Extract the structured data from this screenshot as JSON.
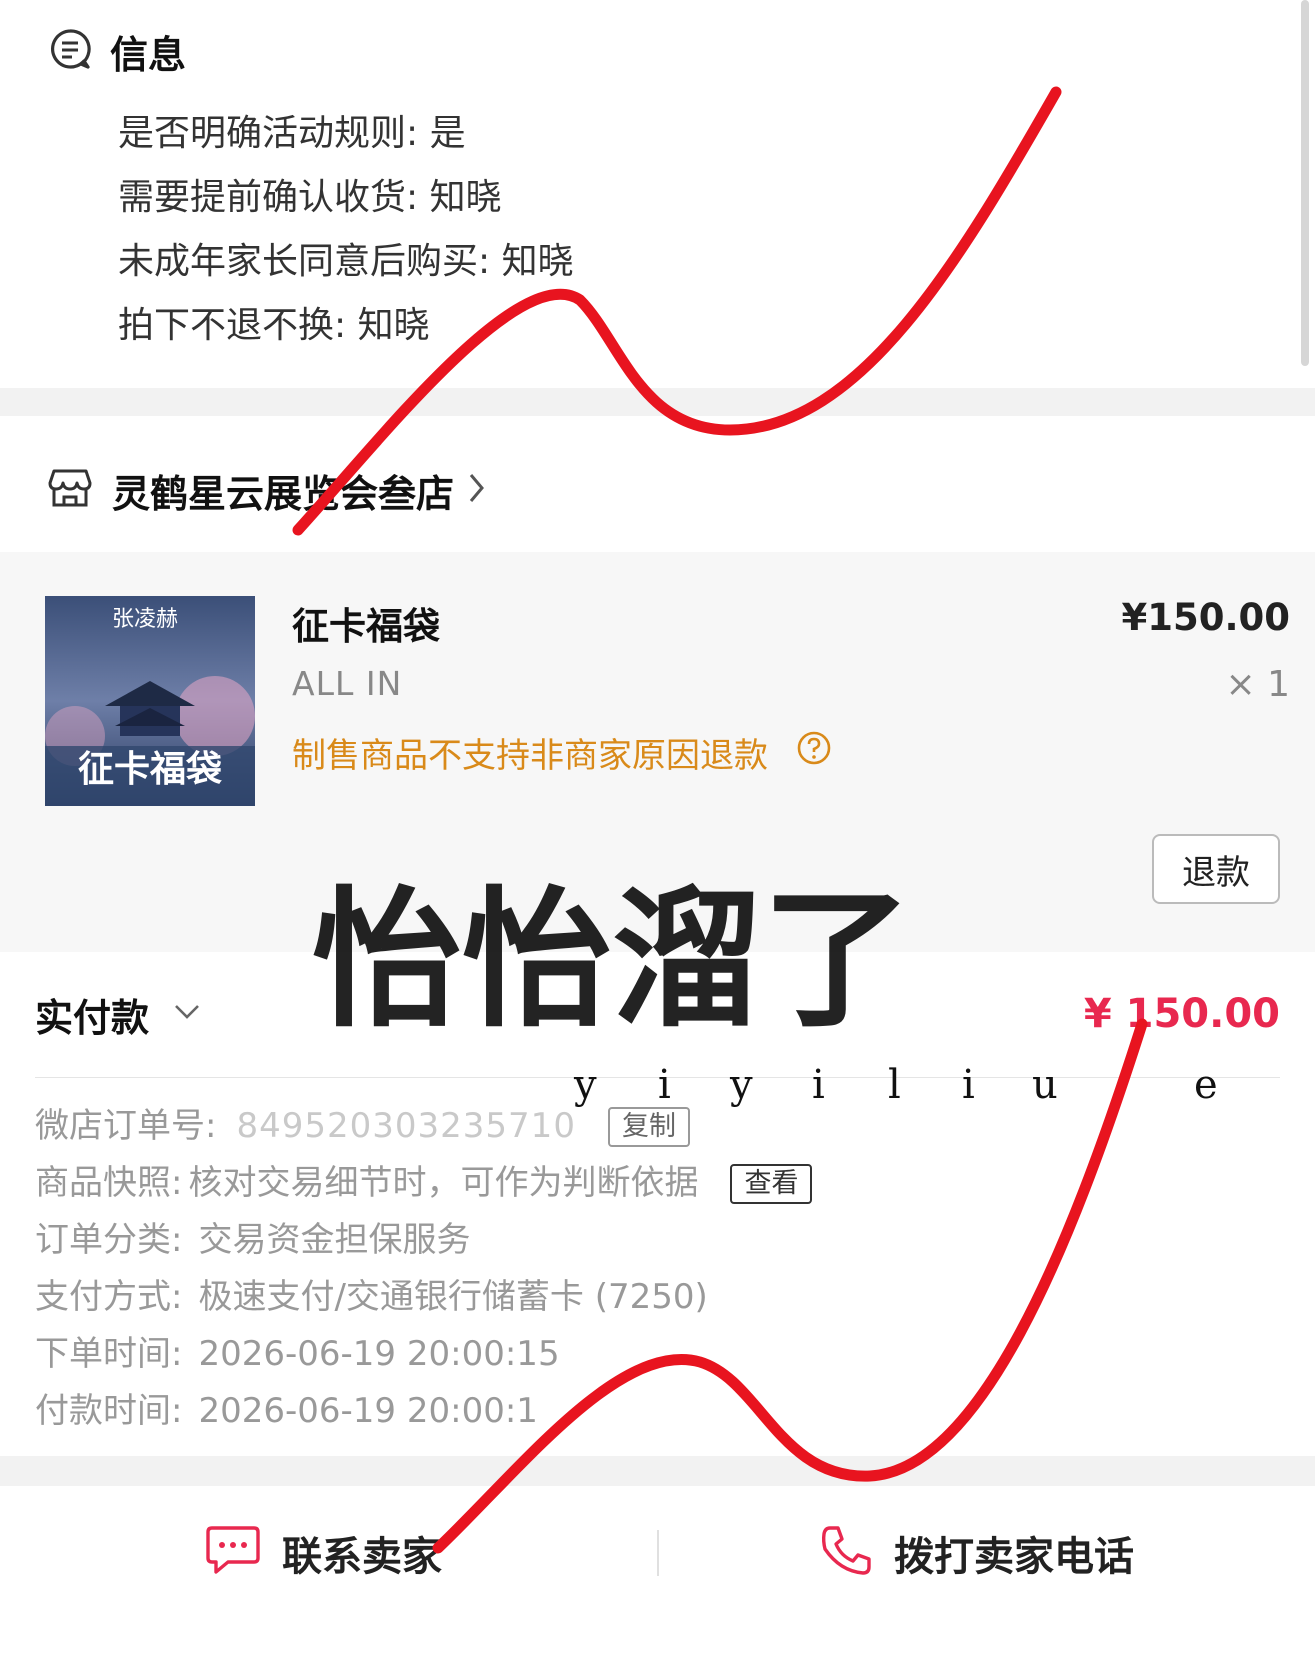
{
  "info": {
    "title": "信息",
    "lines": [
      "是否明确活动规则: 是",
      "需要提前确认收货: 知晓",
      "未成年家长同意后购买: 知晓",
      "拍下不退不换: 知晓"
    ]
  },
  "shop": {
    "name": "灵鹤星云展览会叁店"
  },
  "item": {
    "name": "征卡福袋",
    "sku": "ALL IN",
    "note": "制售商品不支持非商家原因退款",
    "price": "¥150.00",
    "qty": "× 1",
    "refund_label": "退款",
    "thumb_text": "征卡福袋",
    "thumb_name": "张凌赫"
  },
  "payment": {
    "label": "实付款",
    "amount": "¥ 150.00"
  },
  "details": {
    "order_no_label": "微店订单号:",
    "order_no": "849520303235710",
    "copy_label": "复制",
    "snapshot_label": "商品快照:",
    "snapshot_text": "核对交易细节时，可作为判断依据",
    "view_label": "查看",
    "category_label": "订单分类:",
    "category": "交易资金担保服务",
    "pay_method_label": "支付方式:",
    "pay_method": "极速支付/交通银行储蓄卡 (7250)",
    "order_time_label": "下单时间:",
    "order_time": "2026-06-19 20:00:15",
    "pay_time_label": "付款时间:",
    "pay_time": "2026-06-19 20:00:1"
  },
  "bottom": {
    "contact_label": "联系卖家",
    "call_label": "拨打卖家电话"
  },
  "watermark": {
    "script": "怡怡溜了",
    "latin": [
      "y",
      "i",
      "y",
      "i",
      "l",
      "i",
      "u",
      "e"
    ]
  },
  "colors": {
    "accent": "#e8284f",
    "warning": "#d98a1a",
    "red_stroke": "#e8141f"
  }
}
